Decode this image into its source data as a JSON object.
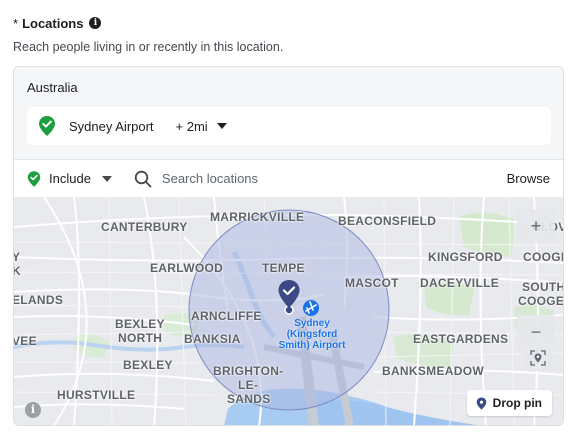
{
  "header": {
    "required_mark": "*",
    "title": "Locations",
    "info_icon": "info-icon"
  },
  "subtitle": "Reach people living in or recently in this location.",
  "country": "Australia",
  "location": {
    "name": "Sydney Airport",
    "radius": "+ 2mi",
    "pin_color": "#1e9e3e"
  },
  "toolbar": {
    "include_label": "Include",
    "search_placeholder": "Search locations",
    "browse_label": "Browse"
  },
  "map": {
    "labels": {
      "marrickville": "MARRICKVILLE",
      "beaconsfield": "BEACONSFIELD",
      "canterbury": "CANTERBURY",
      "clov": "CLOV",
      "kingsford": "KINGSFORD",
      "cooge": "COOGE",
      "earlwood": "EARLWOOD",
      "tempe": "TEMPE",
      "mascot": "MASCOT",
      "daceyville": "DACEYVILLE",
      "south_cooge_1": "SOUTH",
      "south_cooge_2": "COOGE",
      "y_edge": "Y",
      "k_edge": "K",
      "elands": "ELANDS",
      "arncliffe": "ARNCLIFFE",
      "bexley_north_1": "BEXLEY",
      "bexley_north_2": "NORTH",
      "banksia": "BANKSIA",
      "eastgardens": "EASTGARDENS",
      "vee": "VEE",
      "bexley": "BEXLEY",
      "brighton_1": "BRIGHTON-",
      "brighton_2": "LE-",
      "brighton_3": "SANDS",
      "banksmeadow": "BANKSMEADOW",
      "hurstville": "HURSTVILLE",
      "airport_1": "Sydney",
      "airport_2": "(Kingsford",
      "airport_3": "Smith) Airport"
    },
    "drop_pin_label": "Drop pin",
    "zoom_in": "+",
    "zoom_out": "−",
    "info_glyph": "i",
    "radius_fill": "#a9b6e0",
    "marker_color": "#3b4a86"
  }
}
